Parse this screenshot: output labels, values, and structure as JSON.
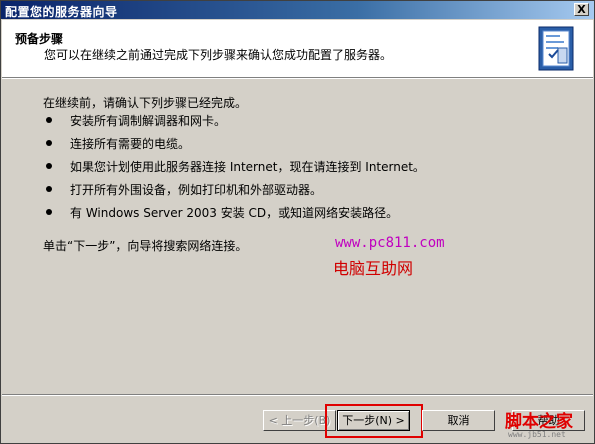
{
  "window": {
    "title": "配置您的服务器向导",
    "close_label": "X"
  },
  "header": {
    "title": "预备步骤",
    "subtitle": "您可以在继续之前通过完成下列步骤来确认您成功配置了服务器。",
    "icon": "server-checklist-icon"
  },
  "content": {
    "intro": "在继续前，请确认下列步骤已经完成。",
    "steps": [
      "安装所有调制解调器和网卡。",
      "连接所有需要的电缆。",
      "如果您计划使用此服务器连接 Internet，现在请连接到 Internet。",
      "打开所有外围设备，例如打印机和外部驱动器。",
      "有 Windows Server 2003 安装 CD，或知道网络安装路径。"
    ],
    "next_note": "单击“下一步”，向导将搜索网络连接。"
  },
  "buttons": {
    "back": "< 上一步(B)",
    "next": "下一步(N) >",
    "cancel": "取消",
    "help": "帮助"
  },
  "watermarks": {
    "url": "www.pc811.com",
    "site_name": "电脑互助网",
    "logo": "脚本之家",
    "logo_url": "www.jb51.net"
  },
  "colors": {
    "titlebar_start": "#0a246a",
    "titlebar_end": "#a6caf0",
    "dialog_bg": "#d4d0c8",
    "highlight_border": "#e00000",
    "watermark_url": "#c000c0"
  }
}
